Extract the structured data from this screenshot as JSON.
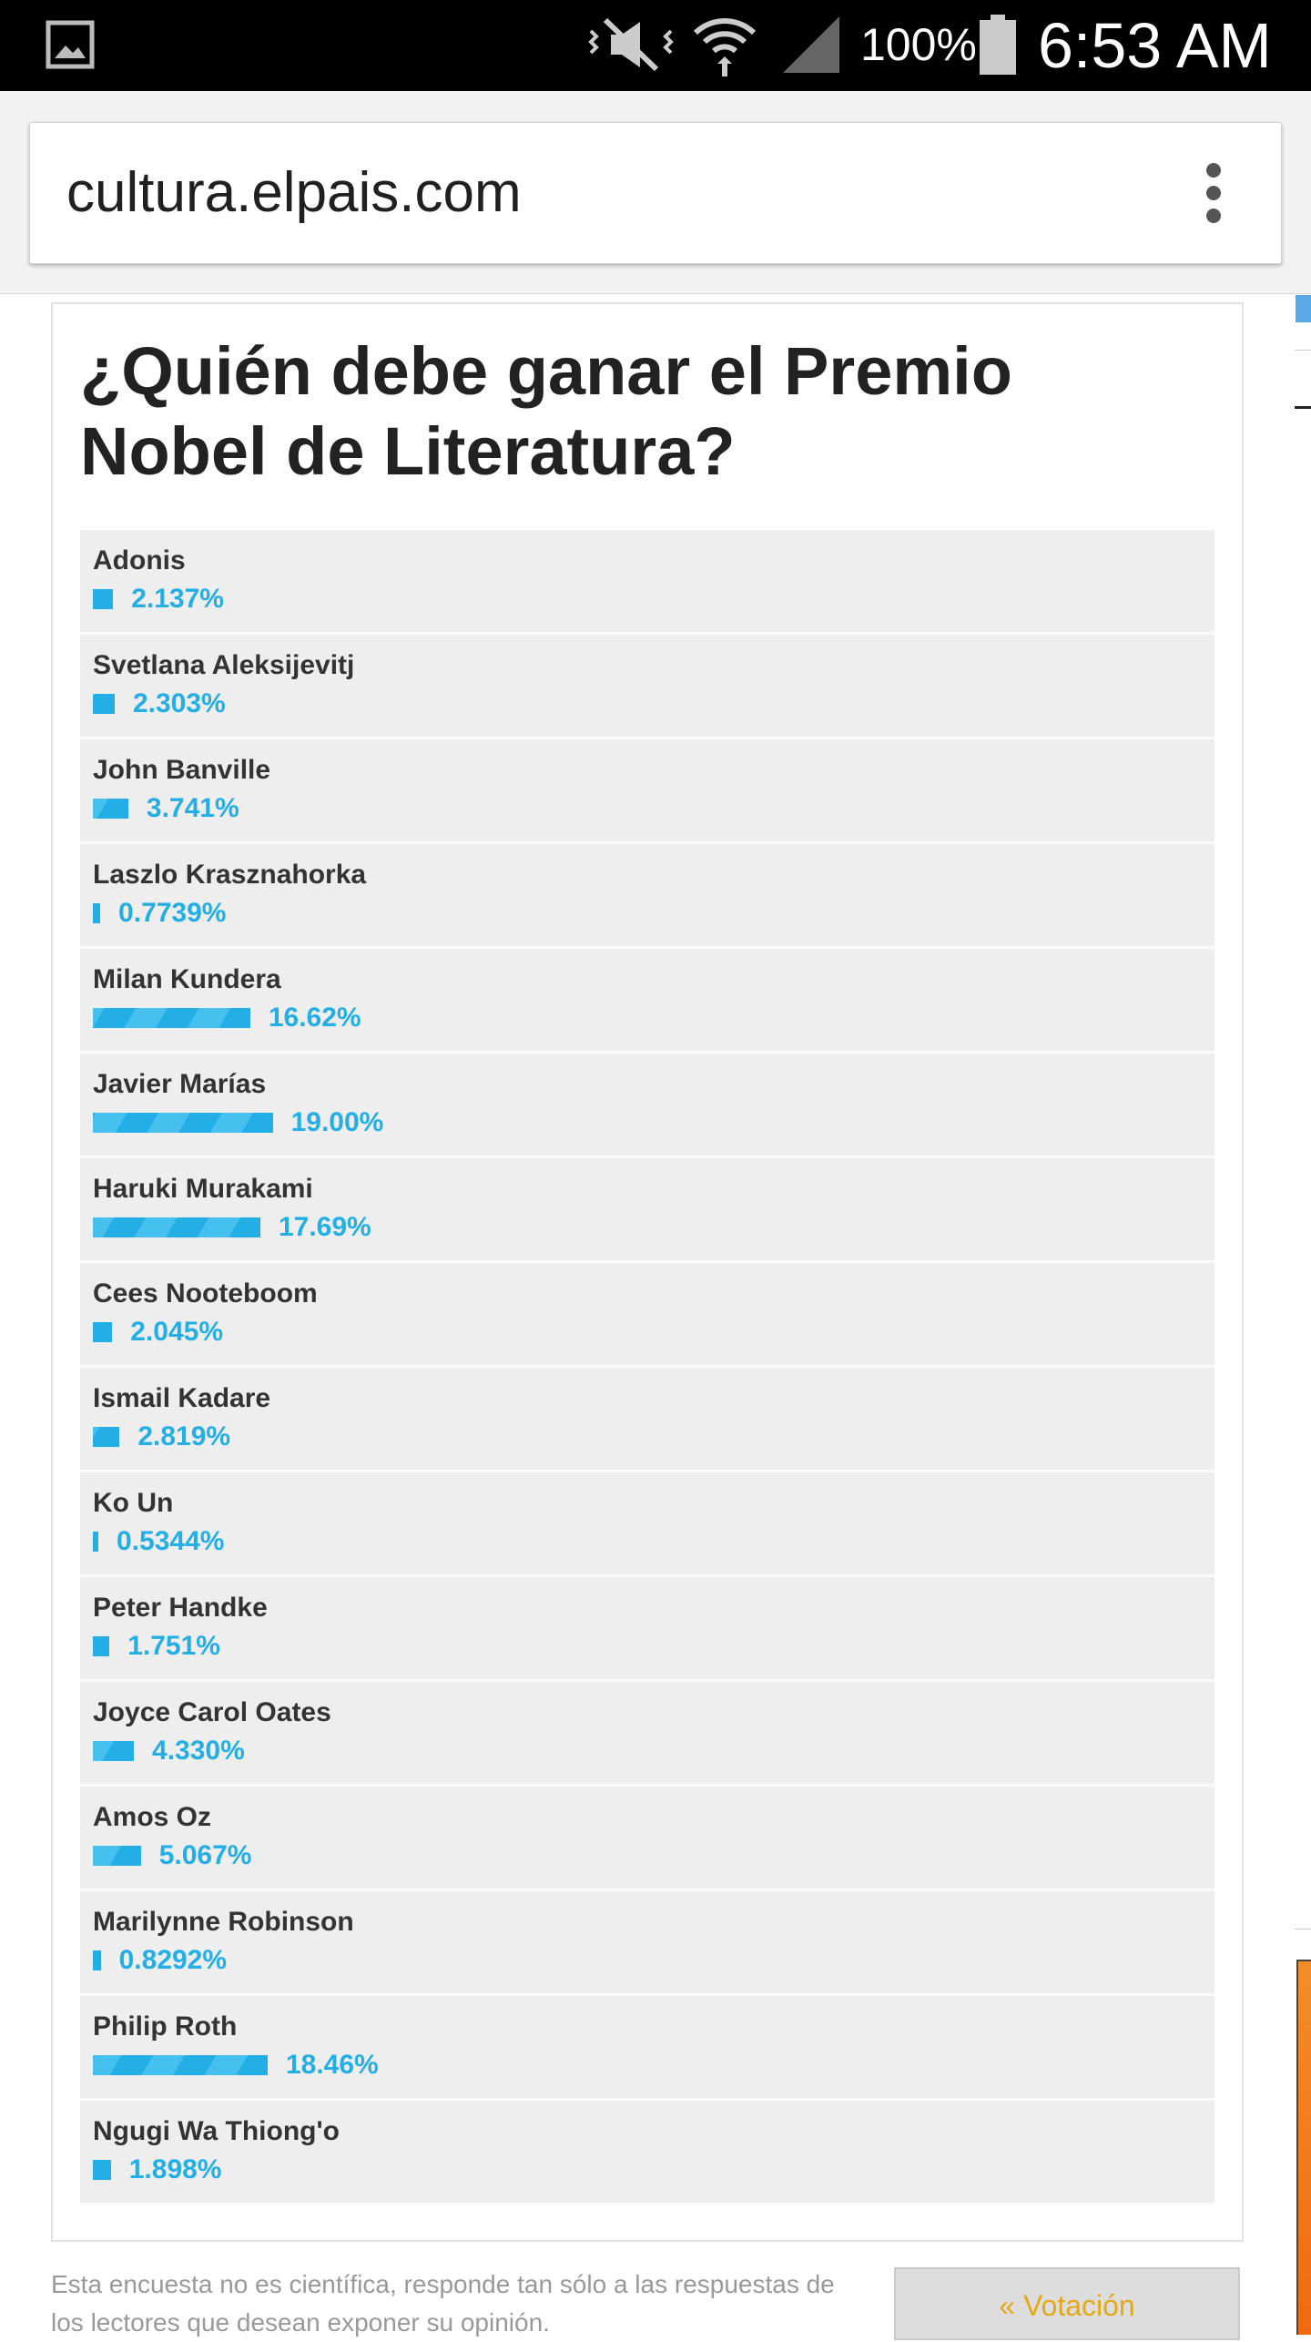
{
  "status_bar": {
    "battery_percent": "100%",
    "time": "6:53 AM",
    "icons": [
      "image-icon",
      "mute-vibrate-icon",
      "wifi-icon",
      "signal-icon",
      "battery-icon"
    ]
  },
  "browser": {
    "url": "cultura.elpais.com",
    "menu_icon": "more-vert-icon"
  },
  "poll": {
    "title": "¿Quién debe ganar el Premio Nobel de Literatura?",
    "items": [
      {
        "name": "Adonis",
        "percent_label": "2.137%",
        "percent": 2.137
      },
      {
        "name": "Svetlana Aleksijevitj",
        "percent_label": "2.303%",
        "percent": 2.303
      },
      {
        "name": "John Banville",
        "percent_label": "3.741%",
        "percent": 3.741
      },
      {
        "name": "Laszlo Krasznahorka",
        "percent_label": "0.7739%",
        "percent": 0.7739
      },
      {
        "name": "Milan Kundera",
        "percent_label": "16.62%",
        "percent": 16.62
      },
      {
        "name": "Javier Marías",
        "percent_label": "19.00%",
        "percent": 19.0
      },
      {
        "name": "Haruki Murakami",
        "percent_label": "17.69%",
        "percent": 17.69
      },
      {
        "name": "Cees Nooteboom",
        "percent_label": "2.045%",
        "percent": 2.045
      },
      {
        "name": "Ismail Kadare",
        "percent_label": "2.819%",
        "percent": 2.819
      },
      {
        "name": "Ko Un",
        "percent_label": "0.5344%",
        "percent": 0.5344
      },
      {
        "name": "Peter Handke",
        "percent_label": "1.751%",
        "percent": 1.751
      },
      {
        "name": "Joyce Carol Oates",
        "percent_label": "4.330%",
        "percent": 4.33
      },
      {
        "name": "Amos Oz",
        "percent_label": "5.067%",
        "percent": 5.067
      },
      {
        "name": "Marilynne Robinson",
        "percent_label": "0.8292%",
        "percent": 0.8292
      },
      {
        "name": "Philip Roth",
        "percent_label": "18.46%",
        "percent": 18.46
      },
      {
        "name": "Ngugi Wa Thiong'o",
        "percent_label": "1.898%",
        "percent": 1.898
      }
    ],
    "colors": {
      "bar": "#23aee6",
      "row_bg": "#eeeeee"
    }
  },
  "footer": {
    "note": "Esta encuesta no es científica, responde tan sólo a las respuestas de los lectores que desean exponer su opinión.",
    "vote_button": "« Votación"
  }
}
